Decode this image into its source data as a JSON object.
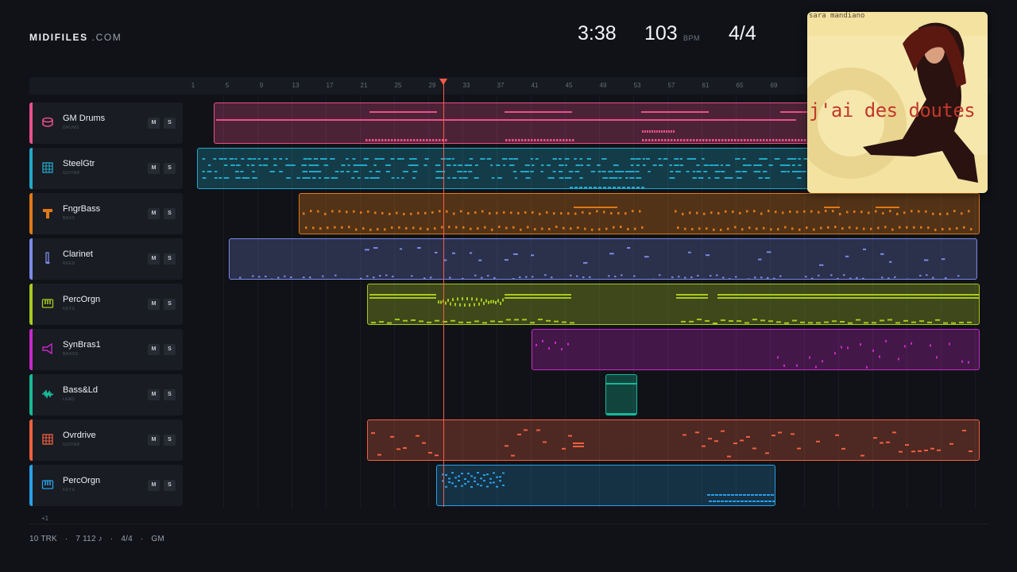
{
  "header": {
    "logo_bold": "MIDIFILES",
    "logo_domain": ".COM",
    "duration": "3:38",
    "tempo": "103",
    "tempo_unit": "BPM",
    "time_signature": "4/4"
  },
  "ruler": {
    "ticks": [
      "1",
      "5",
      "9",
      "13",
      "17",
      "21",
      "25",
      "29",
      "33",
      "37",
      "41",
      "45",
      "49",
      "53",
      "57",
      "61",
      "65",
      "69"
    ]
  },
  "tracks": [
    {
      "name": "GM Drums",
      "category": "DRUMS",
      "color": "#e8508a",
      "icon": "drum-icon"
    },
    {
      "name": "SteelGtr",
      "category": "GUITAR",
      "color": "#22a8c8",
      "icon": "guitar-fretboard-icon"
    },
    {
      "name": "FngrBass",
      "category": "BASS",
      "color": "#e07818",
      "icon": "bass-icon"
    },
    {
      "name": "Clarinet",
      "category": "REED",
      "color": "#7a8ae8",
      "icon": "clarinet-icon"
    },
    {
      "name": "PercOrgn",
      "category": "KEYS",
      "color": "#a8c820",
      "icon": "keyboard-icon"
    },
    {
      "name": "SynBras1",
      "category": "BRASS",
      "color": "#c828c8",
      "icon": "trumpet-icon"
    },
    {
      "name": "Bass&Ld",
      "category": "LEAD",
      "color": "#18b898",
      "icon": "waveform-icon"
    },
    {
      "name": "Ovrdrive",
      "category": "GUITAR",
      "color": "#f06040",
      "icon": "guitar-fretboard-icon"
    },
    {
      "name": "PercOrgn",
      "category": "KEYS",
      "color": "#28a0e8",
      "icon": "keyboard-icon"
    }
  ],
  "buttons": {
    "mute": "M",
    "solo": "S"
  },
  "more_tracks": "+1",
  "status": {
    "tracks": "10 TRK",
    "sep": "·",
    "notes": "7 112 ♪",
    "time_sig": "4/4",
    "standard": "GM"
  },
  "album": {
    "artist": "sara mandiano",
    "title": "j'ai des doutes"
  }
}
